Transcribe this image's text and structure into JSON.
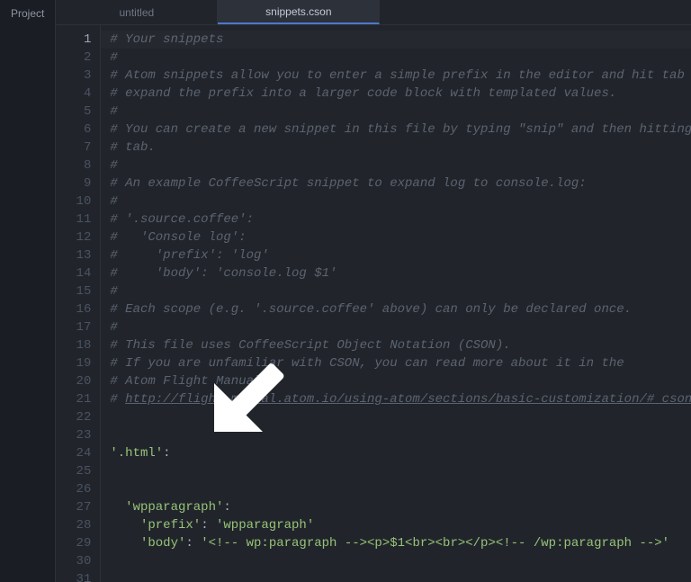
{
  "sidebar": {
    "project_label": "Project"
  },
  "tabs": [
    {
      "label": "untitled",
      "active": false
    },
    {
      "label": "snippets.cson",
      "active": true
    }
  ],
  "editor": {
    "current_line": 1,
    "lines": [
      {
        "n": 1,
        "type": "comment",
        "text": "# Your snippets"
      },
      {
        "n": 2,
        "type": "comment",
        "text": "#"
      },
      {
        "n": 3,
        "type": "comment",
        "text": "# Atom snippets allow you to enter a simple prefix in the editor and hit tab to"
      },
      {
        "n": 4,
        "type": "comment",
        "text": "# expand the prefix into a larger code block with templated values."
      },
      {
        "n": 5,
        "type": "comment",
        "text": "#"
      },
      {
        "n": 6,
        "type": "comment",
        "text": "# You can create a new snippet in this file by typing \"snip\" and then hitting"
      },
      {
        "n": 7,
        "type": "comment",
        "text": "# tab."
      },
      {
        "n": 8,
        "type": "comment",
        "text": "#"
      },
      {
        "n": 9,
        "type": "comment",
        "text": "# An example CoffeeScript snippet to expand log to console.log:"
      },
      {
        "n": 10,
        "type": "comment",
        "text": "#"
      },
      {
        "n": 11,
        "type": "comment",
        "text": "# '.source.coffee':"
      },
      {
        "n": 12,
        "type": "comment",
        "text": "#   'Console log':"
      },
      {
        "n": 13,
        "type": "comment",
        "text": "#     'prefix': 'log'"
      },
      {
        "n": 14,
        "type": "comment",
        "text": "#     'body': 'console.log $1'"
      },
      {
        "n": 15,
        "type": "comment",
        "text": "#"
      },
      {
        "n": 16,
        "type": "comment",
        "text": "# Each scope (e.g. '.source.coffee' above) can only be declared once."
      },
      {
        "n": 17,
        "type": "comment",
        "text": "#"
      },
      {
        "n": 18,
        "type": "comment",
        "text": "# This file uses CoffeeScript Object Notation (CSON)."
      },
      {
        "n": 19,
        "type": "comment",
        "text": "# If you are unfamiliar with CSON, you can read more about it in the"
      },
      {
        "n": 20,
        "type": "comment",
        "text": "# Atom Flight Manual:"
      },
      {
        "n": 21,
        "type": "comment-link",
        "prefix": "# ",
        "link": "http://flight-manual.atom.io/using-atom/sections/basic-customization/#_cson"
      },
      {
        "n": 22,
        "type": "blank",
        "text": ""
      },
      {
        "n": 23,
        "type": "blank",
        "text": ""
      },
      {
        "n": 24,
        "type": "key0",
        "key": "'.html'"
      },
      {
        "n": 25,
        "type": "blank",
        "text": ""
      },
      {
        "n": 26,
        "type": "blank",
        "text": ""
      },
      {
        "n": 27,
        "type": "key1",
        "key": "'wpparagraph'"
      },
      {
        "n": 28,
        "type": "kv2",
        "key": "'prefix'",
        "val": "'wpparagraph'"
      },
      {
        "n": 29,
        "type": "kv2",
        "key": "'body'",
        "val": "'<!-- wp:paragraph --><p>$1<br><br></p><!-- /wp:paragraph -->'"
      },
      {
        "n": 30,
        "type": "blank",
        "text": ""
      },
      {
        "n": 31,
        "type": "blank",
        "text": ""
      }
    ]
  }
}
